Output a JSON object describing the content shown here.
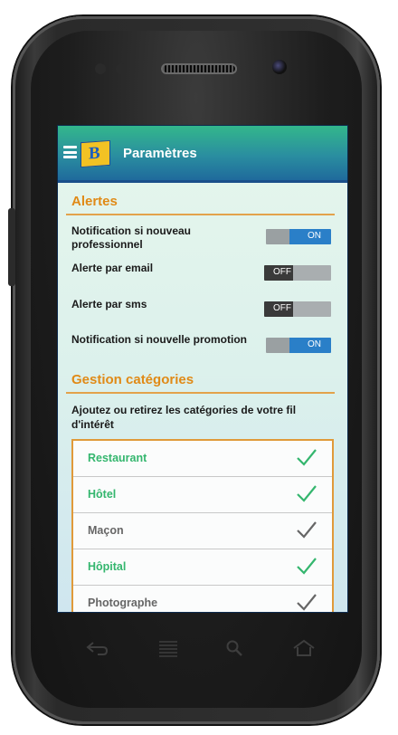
{
  "appbar": {
    "title": "Paramètres",
    "menu_icon": "hamburger-icon",
    "logo_icon": "app-logo-icon"
  },
  "alerts": {
    "title": "Alertes",
    "items": [
      {
        "label": "Notification si nouveau professionnel",
        "state": "ON"
      },
      {
        "label": "Alerte par email",
        "state": "OFF"
      },
      {
        "label": "Alerte par sms",
        "state": "OFF"
      },
      {
        "label": "Notification si nouvelle promotion",
        "state": "ON"
      }
    ]
  },
  "categories": {
    "title": "Gestion catégories",
    "description": "Ajoutez ou retirez les catégories de votre fil d'intérêt",
    "items": [
      {
        "name": "Restaurant",
        "selected": true
      },
      {
        "name": "Hôtel",
        "selected": true
      },
      {
        "name": "Maçon",
        "selected": false
      },
      {
        "name": "Hôpital",
        "selected": true
      },
      {
        "name": "Photographe",
        "selected": false
      }
    ]
  },
  "colors": {
    "accent": "#e08a17",
    "selected": "#34b66e",
    "toggle_on": "#2a7fc8",
    "appbar_top": "#33b78b",
    "appbar_bottom": "#1f6a9c"
  },
  "device_nav_icons": [
    "back-icon",
    "menu-icon",
    "search-icon",
    "home-icon"
  ]
}
